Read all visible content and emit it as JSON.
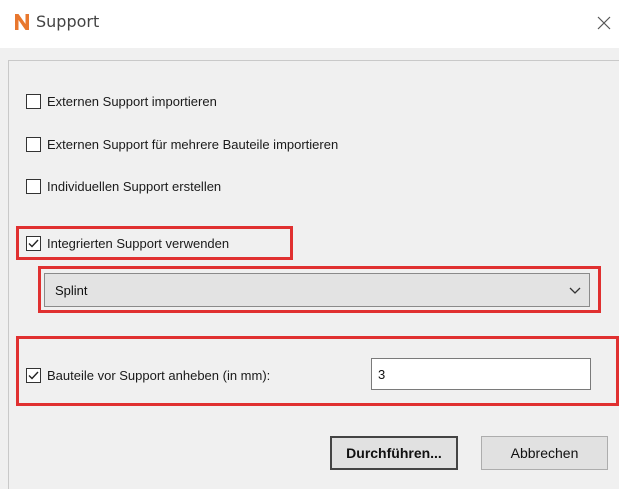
{
  "window": {
    "title": "Support",
    "logo_letter": "N",
    "logo_color": "#e8772e"
  },
  "options": {
    "import_external": {
      "label": "Externen Support importieren",
      "checked": false
    },
    "import_external_multi": {
      "label": "Externen Support für mehrere Bauteile importieren",
      "checked": false
    },
    "create_custom": {
      "label": "Individuellen Support erstellen",
      "checked": false
    },
    "use_integrated": {
      "label": "Integrierten Support verwenden",
      "checked": true
    }
  },
  "support_type": {
    "selected": "Splint"
  },
  "lift_parts": {
    "label": "Bauteile vor Support anheben (in mm):",
    "checked": true,
    "value": "3"
  },
  "buttons": {
    "execute": "Durchführen...",
    "cancel": "Abbrechen"
  },
  "colors": {
    "highlight": "#e03030",
    "dialog_bg": "#f0f0f0"
  }
}
